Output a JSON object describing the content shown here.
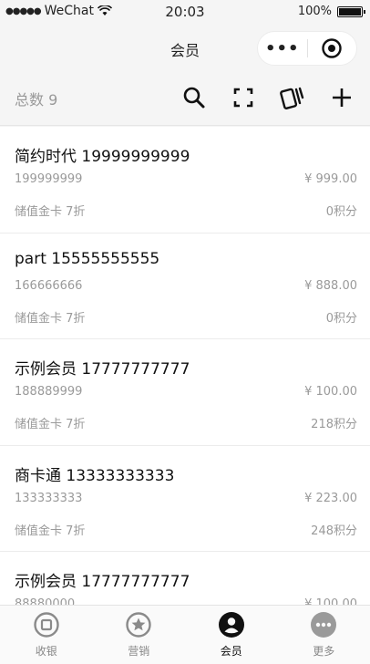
{
  "status_bar": {
    "carrier": "WeChat",
    "time": "20:03",
    "battery": "100%"
  },
  "nav": {
    "title": "会员",
    "more_glyph": "•••"
  },
  "toolbar": {
    "total_label": "总数 9",
    "icons": [
      "search-icon",
      "scan-icon",
      "cards-icon",
      "add-icon"
    ]
  },
  "members": [
    {
      "name": "简约时代 19999999999",
      "card_no": "199999999",
      "amount": "¥ 999.00",
      "card_type": "储值金卡 7折",
      "points": "0积分"
    },
    {
      "name": "part 15555555555",
      "card_no": "166666666",
      "amount": "¥ 888.00",
      "card_type": "储值金卡 7折",
      "points": "0积分"
    },
    {
      "name": "示例会员 17777777777",
      "card_no": "188889999",
      "amount": "¥ 100.00",
      "card_type": "储值金卡 7折",
      "points": "218积分"
    },
    {
      "name": "商卡通 13333333333",
      "card_no": "133333333",
      "amount": "¥ 223.00",
      "card_type": "储值金卡 7折",
      "points": "248积分"
    },
    {
      "name": "示例会员 17777777777",
      "card_no": "88880000",
      "amount": "¥ 100.00",
      "card_type": "",
      "points": ""
    }
  ],
  "tabs": [
    {
      "label": "收银",
      "icon": "cashier-icon",
      "active": false
    },
    {
      "label": "营销",
      "icon": "star-icon",
      "active": false
    },
    {
      "label": "会员",
      "icon": "member-icon",
      "active": true
    },
    {
      "label": "更多",
      "icon": "more-icon",
      "active": false
    }
  ],
  "colors": {
    "background": "#f5f5f5",
    "text_primary": "#111111",
    "text_secondary": "#9a9a9a",
    "tab_inactive": "#888888"
  }
}
